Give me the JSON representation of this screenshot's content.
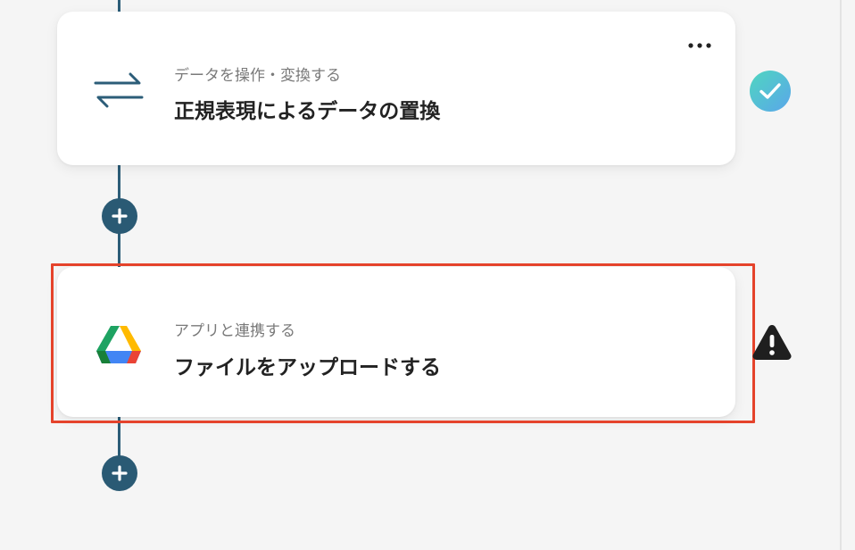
{
  "flow": {
    "steps": [
      {
        "subtitle": "データを操作・変換する",
        "title": "正規表現によるデータの置換",
        "icon": "swap-arrows-icon",
        "status": "complete",
        "menu_icon": "more-horizontal-icon"
      },
      {
        "subtitle": "アプリと連携する",
        "title": "ファイルをアップロードする",
        "icon": "google-drive-icon",
        "status": "warning",
        "selected": true
      }
    ],
    "add_step_icon": "plus-icon"
  },
  "colors": {
    "connector": "#2c5d78",
    "add_button": "#2a5a74",
    "check_gradient_start": "#4fd1c5",
    "check_gradient_end": "#5aa9e6",
    "warning": "#1f1f1f",
    "selection_outline": "#e5432b",
    "background": "#f5f5f5",
    "card": "#ffffff"
  }
}
